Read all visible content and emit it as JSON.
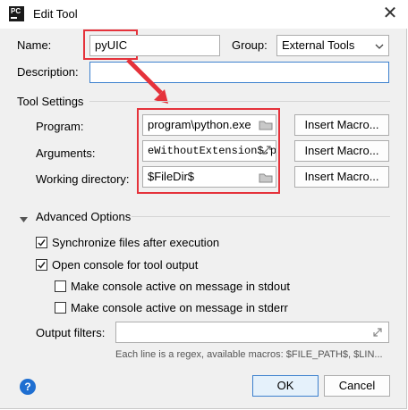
{
  "window": {
    "title": "Edit Tool",
    "app_icon": "PC"
  },
  "name": {
    "label": "Name:",
    "value": "pyUIC"
  },
  "group": {
    "label": "Group:",
    "value": "External Tools"
  },
  "description": {
    "label": "Description:",
    "value": ""
  },
  "tool_settings": {
    "header": "Tool Settings",
    "program": {
      "label": "Program:",
      "value": "program\\python.exe"
    },
    "arguments": {
      "label": "Arguments:",
      "value": "eWithoutExtension$.py"
    },
    "working_directory": {
      "label": "Working directory:",
      "value": "$FileDir$"
    },
    "insert_macro_label": "Insert Macro..."
  },
  "advanced": {
    "header": "Advanced Options",
    "sync_files": {
      "label": "Synchronize files after execution",
      "checked": true
    },
    "open_console": {
      "label": "Open console for tool output",
      "checked": true
    },
    "console_stdout": {
      "label": "Make console active on message in stdout",
      "checked": false
    },
    "console_stderr": {
      "label": "Make console active on message in stderr",
      "checked": false
    },
    "output_filters": {
      "label": "Output filters:",
      "value": ""
    },
    "hint": "Each line is a regex, available macros: $FILE_PATH$, $LIN..."
  },
  "buttons": {
    "ok": "OK",
    "cancel": "Cancel",
    "help": "?"
  },
  "colors": {
    "highlight": "#e5323b",
    "help": "#1f6fd1",
    "focus": "#3c80ce"
  }
}
